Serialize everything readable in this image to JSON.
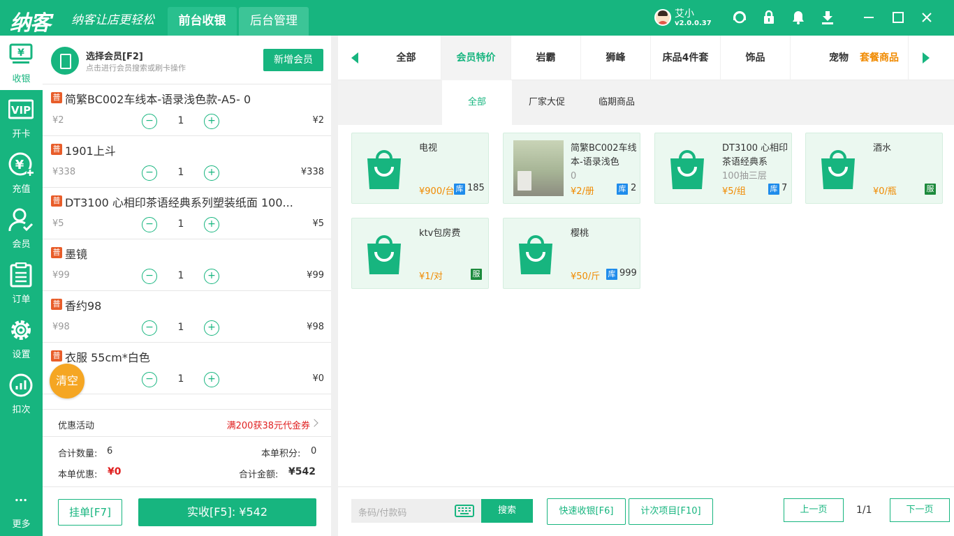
{
  "app": {
    "logo": "纳客",
    "slogan": "纳客让店更轻松",
    "tabs": [
      "前台收银",
      "后台管理"
    ],
    "user_name": "艾小",
    "version": "v2.0.0.37",
    "brand_color": "#17b57f"
  },
  "nav": [
    {
      "label": "收银",
      "icon": "cashier-icon"
    },
    {
      "label": "开卡",
      "icon": "vip-card-icon"
    },
    {
      "label": "充值",
      "icon": "recharge-icon"
    },
    {
      "label": "会员",
      "icon": "member-icon"
    },
    {
      "label": "订单",
      "icon": "order-icon"
    },
    {
      "label": "设置",
      "icon": "settings-icon"
    },
    {
      "label": "扣次",
      "icon": "deduct-icon"
    },
    {
      "label": "更多",
      "icon": "more-icon"
    }
  ],
  "member": {
    "title": "选择会员[F2]",
    "subtitle": "点击进行会员搜索或刷卡操作",
    "add_label": "新增会员"
  },
  "cart": {
    "badge": "普",
    "items": [
      {
        "name": "简繁BC002车线本-语录浅色款-A5- 0",
        "price": "¥2",
        "qty": "1",
        "total": "¥2"
      },
      {
        "name": "1901上斗",
        "price": "¥338",
        "qty": "1",
        "total": "¥338"
      },
      {
        "name": "DT3100 心相印茶语经典系列塑装纸面 100...",
        "price": "¥5",
        "qty": "1",
        "total": "¥5"
      },
      {
        "name": "墨镜",
        "price": "¥99",
        "qty": "1",
        "total": "¥99"
      },
      {
        "name": "香约98",
        "price": "¥98",
        "qty": "1",
        "total": "¥98"
      },
      {
        "name": "衣服 55cm*白色",
        "price": "",
        "qty": "1",
        "total": "¥0"
      }
    ],
    "minus": "−",
    "plus": "+",
    "clear_label": "清空",
    "promo_label": "优惠活动",
    "promo_value": "满200获38元代金券",
    "total_qty_label": "合计数量:",
    "total_qty": "6",
    "points_label": "本单积分:",
    "points": "0",
    "discount_label": "本单优惠:",
    "discount": "¥0",
    "amount_label": "合计金额:",
    "amount": "¥542",
    "hold_label": "挂单[F7]",
    "pay_label": "实收[F5]: ¥542"
  },
  "categories": [
    "全部",
    "会员特价",
    "岩霸",
    "狮峰",
    "床品4件套",
    "饰品",
    "宠物",
    "套餐商品"
  ],
  "subcategories": [
    "全部",
    "厂家大促",
    "临期商品"
  ],
  "products": [
    {
      "name": "电视",
      "name_gray": "",
      "price": "¥900/台",
      "tag": "库",
      "stock": "185",
      "photo": false
    },
    {
      "name": "简繁BC002车线本-语录浅色",
      "name_gray": "0",
      "price": "¥2/册",
      "tag": "库",
      "stock": "2",
      "photo": true
    },
    {
      "name": "DT3100 心相印茶语经典系",
      "name_gray": "100抽三层",
      "price": "¥5/组",
      "tag": "库",
      "stock": "7",
      "photo": false
    },
    {
      "name": "酒水",
      "name_gray": "",
      "price": "¥0/瓶",
      "tag": "服",
      "stock": "",
      "photo": false
    },
    {
      "name": "ktv包房费",
      "name_gray": "",
      "price": "¥1/对",
      "tag": "服",
      "stock": "",
      "photo": false
    },
    {
      "name": "樱桃",
      "name_gray": "",
      "price": "¥50/斤",
      "tag": "库",
      "stock": "999",
      "photo": false
    }
  ],
  "footer": {
    "search_placeholder": "条码/付款码",
    "search_label": "搜索",
    "quick_label": "快速收银[F6]",
    "count_label": "计次项目[F10]",
    "prev_label": "上一页",
    "page": "1/1",
    "next_label": "下一页"
  }
}
